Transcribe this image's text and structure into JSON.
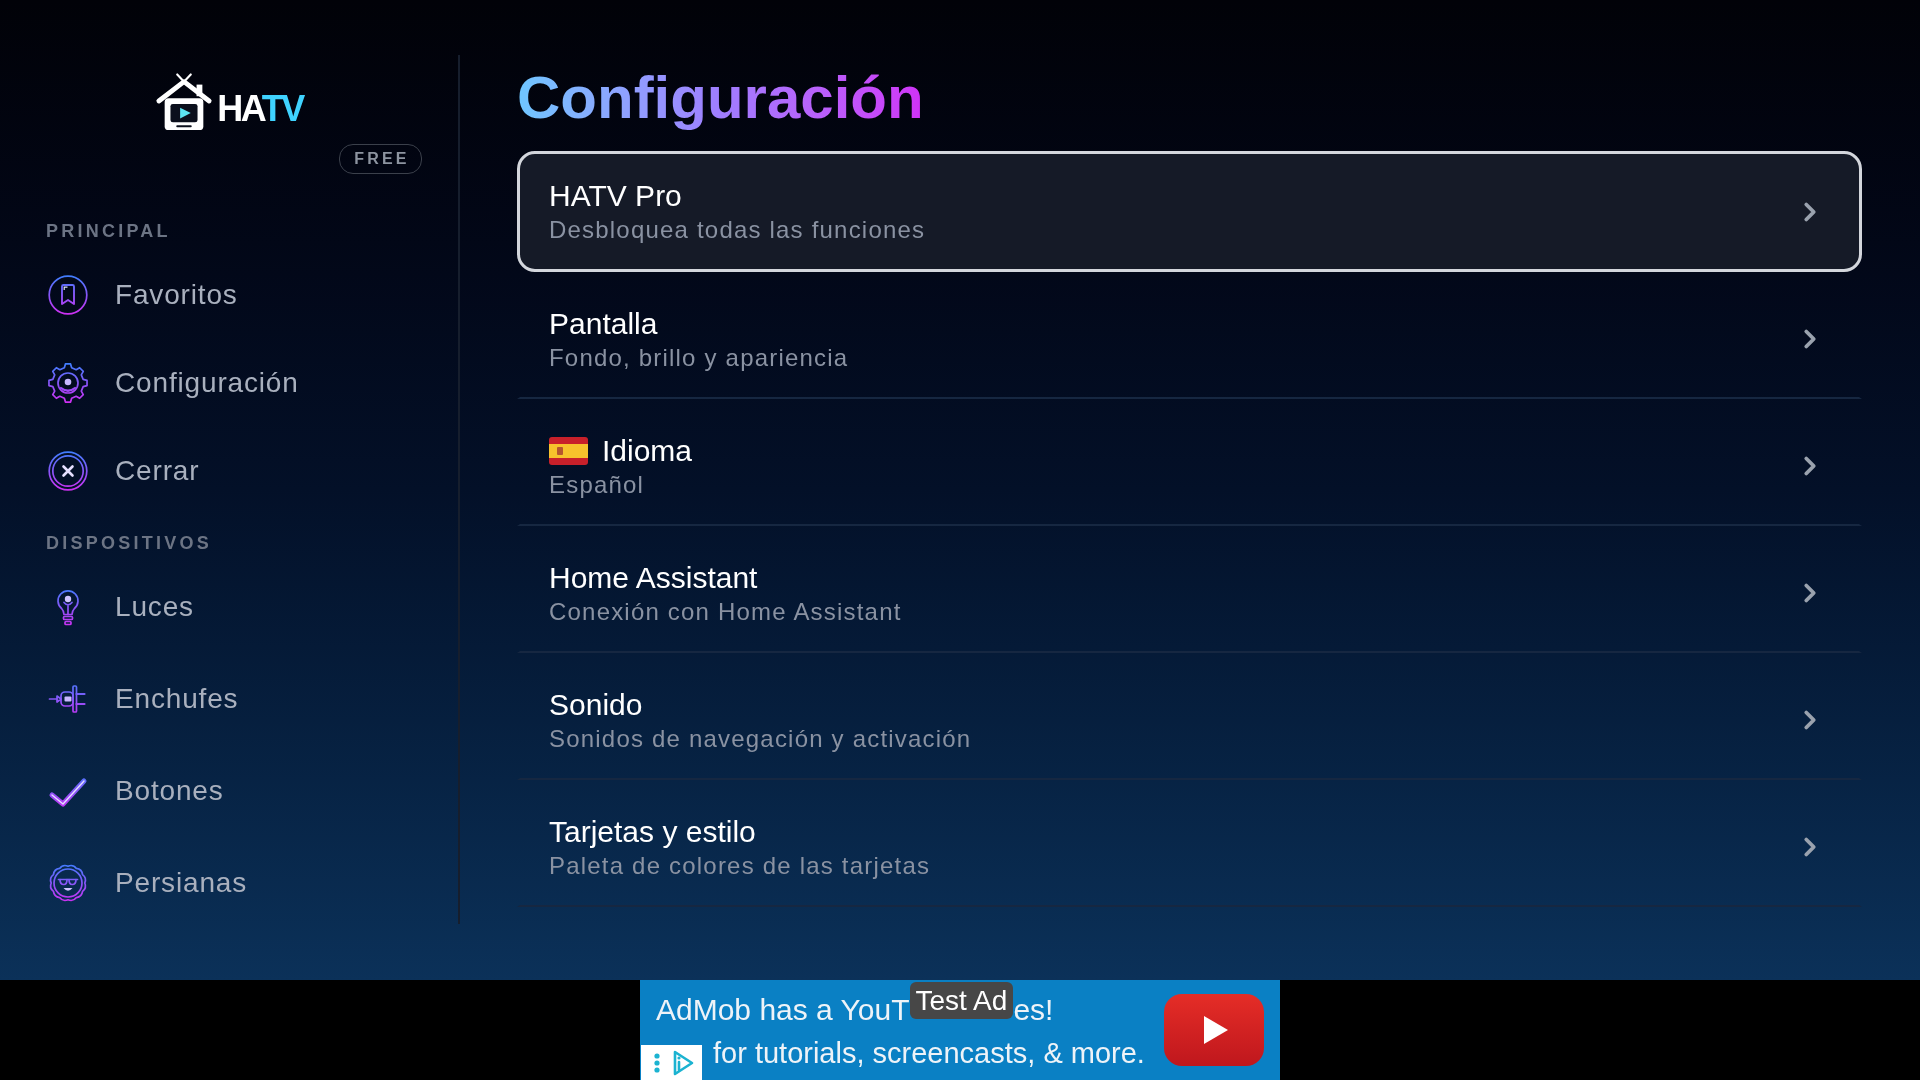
{
  "sidebar": {
    "logo": {
      "text_main": "HA",
      "text_accent": "TV"
    },
    "plan_badge": "FREE",
    "sections": [
      {
        "heading": "PRINCIPAL",
        "items": [
          {
            "label": "Favoritos"
          },
          {
            "label": "Configuración"
          },
          {
            "label": "Cerrar"
          }
        ]
      },
      {
        "heading": "DISPOSITIVOS",
        "items": [
          {
            "label": "Luces"
          },
          {
            "label": "Enchufes"
          },
          {
            "label": "Botones"
          },
          {
            "label": "Persianas"
          }
        ]
      }
    ]
  },
  "page": {
    "title": "Configuración",
    "settings": [
      {
        "kind": "option",
        "title": "HATV Pro",
        "subtitle": "Desbloquea todas las funciones",
        "selected": true
      },
      {
        "kind": "option",
        "title": "Pantalla",
        "subtitle": "Fondo, brillo y apariencia",
        "selected": false
      },
      {
        "kind": "language",
        "title": "Idioma",
        "subtitle": "Español",
        "selected": false
      },
      {
        "kind": "option",
        "title": "Home Assistant",
        "subtitle": "Conexión con Home Assistant",
        "selected": false
      },
      {
        "kind": "option",
        "title": "Sonido",
        "subtitle": "Sonidos de navegación y activación",
        "selected": false
      },
      {
        "kind": "option",
        "title": "Tarjetas y estilo",
        "subtitle": "Paleta de colores de las tarjetas",
        "selected": false
      }
    ]
  },
  "ad_banner": {
    "label": "Test Ad",
    "headline_start": "AdMob has a YouT",
    "headline_end": "es!",
    "description": "for tutorials, screencasts, & more."
  }
}
